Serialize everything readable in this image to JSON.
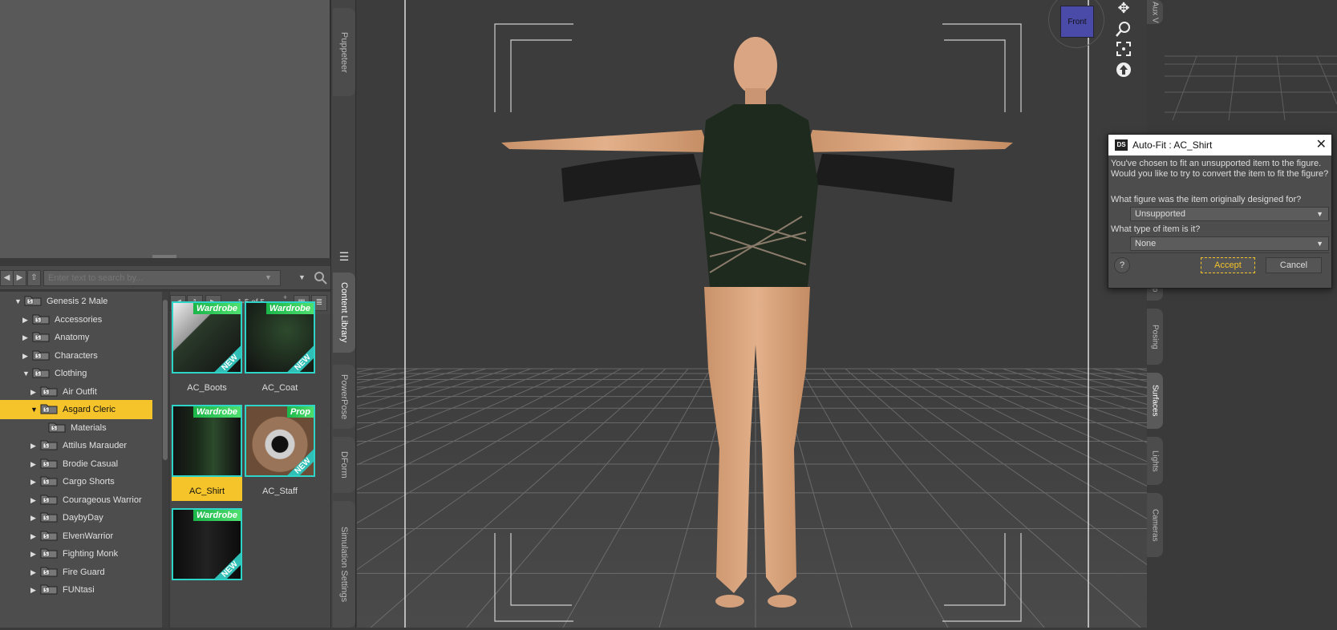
{
  "search": {
    "placeholder": "Enter text to search by..."
  },
  "tree": {
    "items": [
      {
        "label": "Genesis 2 Male",
        "depth": 0,
        "expanded": true
      },
      {
        "label": "Accessories",
        "depth": 1,
        "expanded": false
      },
      {
        "label": "Anatomy",
        "depth": 1,
        "expanded": false
      },
      {
        "label": "Characters",
        "depth": 1,
        "expanded": false
      },
      {
        "label": "Clothing",
        "depth": 1,
        "expanded": true
      },
      {
        "label": "Air Outfit",
        "depth": 2,
        "expanded": false
      },
      {
        "label": "Asgard Cleric",
        "depth": 2,
        "expanded": true,
        "selected": true
      },
      {
        "label": "Materials",
        "depth": 3,
        "leaf": true
      },
      {
        "label": "Attilus Marauder",
        "depth": 2,
        "expanded": false
      },
      {
        "label": "Brodie Casual",
        "depth": 2,
        "expanded": false
      },
      {
        "label": "Cargo Shorts",
        "depth": 2,
        "expanded": false
      },
      {
        "label": "Courageous Warrior",
        "depth": 2,
        "expanded": false
      },
      {
        "label": "DaybyDay",
        "depth": 2,
        "expanded": false
      },
      {
        "label": "ElvenWarrior",
        "depth": 2,
        "expanded": false
      },
      {
        "label": "Fighting Monk",
        "depth": 2,
        "expanded": false
      },
      {
        "label": "Fire Guard",
        "depth": 2,
        "expanded": false
      },
      {
        "label": "FUNtasi",
        "depth": 2,
        "expanded": false
      }
    ]
  },
  "grid": {
    "page": "1",
    "range": "1-5 of 5",
    "tiles": [
      {
        "label": "AC_Boots",
        "badge": "Wardrobe",
        "new": "NEW",
        "selected": false
      },
      {
        "label": "AC_Coat",
        "badge": "Wardrobe",
        "new": "NEW",
        "selected": false
      },
      {
        "label": "AC_Shirt",
        "badge": "Wardrobe",
        "new": "",
        "selected": true
      },
      {
        "label": "AC_Staff",
        "badge": "Prop",
        "new": "NEW",
        "selected": false
      },
      {
        "label": "",
        "badge": "Wardrobe",
        "new": "NEW",
        "selected": false
      }
    ]
  },
  "side_tabs": [
    "Puppeteer",
    "Content Library",
    "PowerPose",
    "DForm",
    "Simulation Settings"
  ],
  "right_tabs": [
    "Aux V",
    "Shap",
    "Posing",
    "Surfaces",
    "Lights",
    "Cameras"
  ],
  "viewport": {
    "view_cube_label": "Front"
  },
  "dialog": {
    "title": "Auto-Fit : AC_Shirt",
    "logo": "DS",
    "message_line1": "You've chosen to fit an unsupported item to the figure.",
    "message_line2": "Would you like to try to convert the item to fit the figure?",
    "q1": "What figure was the item originally designed for?",
    "q1_value": "Unsupported",
    "q2": "What type of item is it?",
    "q2_value": "None",
    "help": "?",
    "accept": "Accept",
    "cancel": "Cancel"
  },
  "colors": {
    "selection": "#f5c32a",
    "badge_green": "#1bb54a",
    "tile_border": "#2fd4c8",
    "view_cube": "#4a4aa8"
  }
}
